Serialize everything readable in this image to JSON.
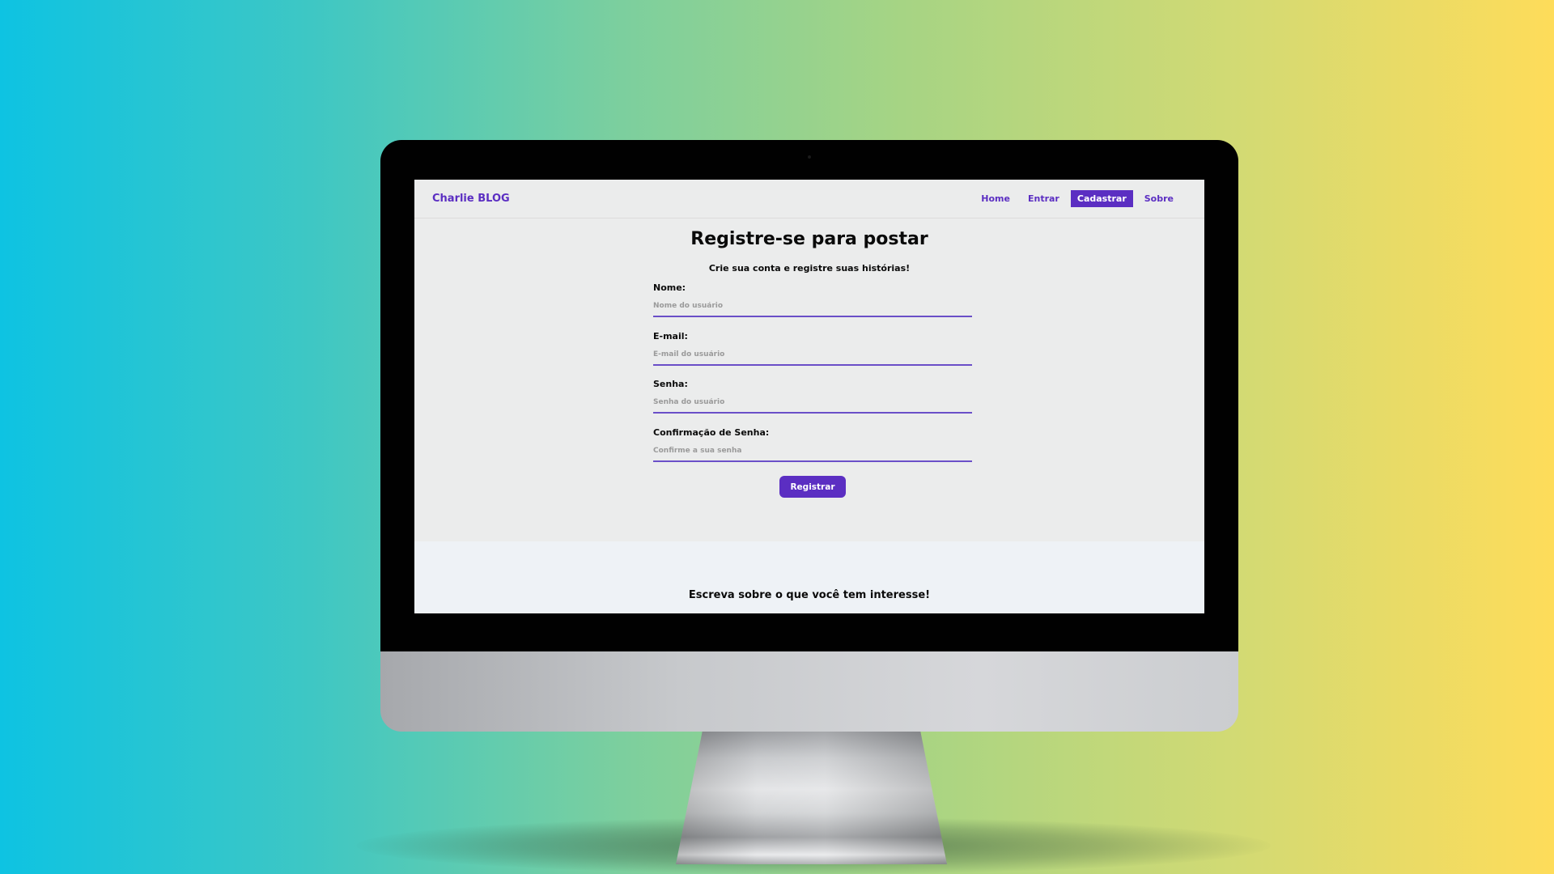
{
  "site": {
    "brand": "Charlie BLOG"
  },
  "nav": {
    "items": [
      {
        "label": "Home",
        "active": false
      },
      {
        "label": "Entrar",
        "active": false
      },
      {
        "label": "Cadastrar",
        "active": true
      },
      {
        "label": "Sobre",
        "active": false
      }
    ]
  },
  "form": {
    "title": "Registre-se para postar",
    "subtitle": "Crie sua conta e registre suas histórias!",
    "fields": [
      {
        "label": "Nome:",
        "placeholder": "Nome do usuário",
        "value": ""
      },
      {
        "label": "E-mail:",
        "placeholder": "E-mail do usuário",
        "value": ""
      },
      {
        "label": "Senha:",
        "placeholder": "Senha do usuário",
        "value": ""
      },
      {
        "label": "Confirmação de Senha:",
        "placeholder": "Confirme a sua senha",
        "value": ""
      }
    ],
    "submit_label": "Registrar"
  },
  "footer": {
    "text": "Escreva sobre o que você tem interesse!"
  },
  "colors": {
    "accent": "#5b2ec2",
    "input_underline": "#6a4fc8",
    "page_background": "#ebecec",
    "footer_background": "#eef2f6",
    "backdrop_gradient_left": "#0ec3e2",
    "backdrop_gradient_right": "#fedc5a"
  },
  "icons": {
    "device": "desktop-monitor",
    "camera": "webcam-dot"
  }
}
